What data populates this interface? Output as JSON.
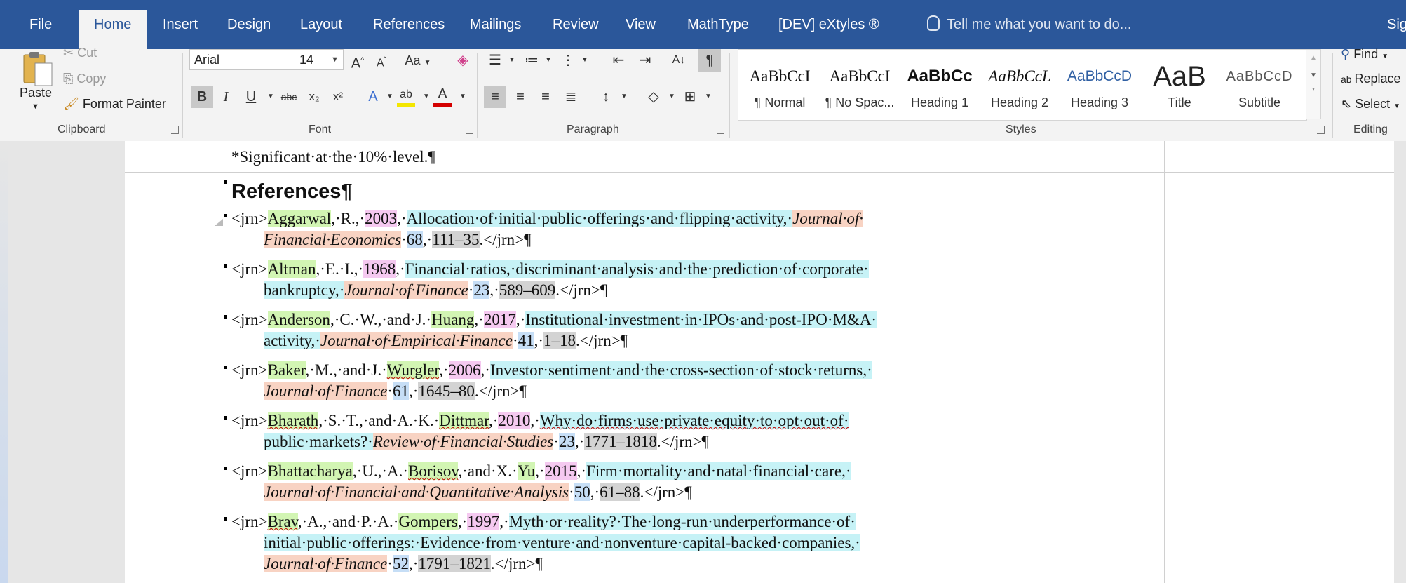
{
  "tabs": [
    {
      "label": "File",
      "active": false
    },
    {
      "label": "Home",
      "active": true
    },
    {
      "label": "Insert",
      "active": false
    },
    {
      "label": "Design",
      "active": false
    },
    {
      "label": "Layout",
      "active": false
    },
    {
      "label": "References",
      "active": false
    },
    {
      "label": "Mailings",
      "active": false
    },
    {
      "label": "Review",
      "active": false
    },
    {
      "label": "View",
      "active": false
    },
    {
      "label": "MathType",
      "active": false
    },
    {
      "label": "[DEV] eXtyles ®",
      "active": false
    }
  ],
  "tell_me": "Tell me what you want to do...",
  "signin": "Sig",
  "clipboard": {
    "label": "Clipboard",
    "paste": "Paste",
    "cut": "Cut",
    "copy": "Copy",
    "format_painter": "Format Painter"
  },
  "font": {
    "label": "Font",
    "family": "Arial",
    "size": "14",
    "case_label": "Aa",
    "superscript": "x²",
    "subscript": "x₂",
    "strike": "abc"
  },
  "paragraph": {
    "label": "Paragraph"
  },
  "styles": {
    "label": "Styles",
    "items": [
      {
        "sample": "AaBbCcI",
        "name": "¶ Normal"
      },
      {
        "sample": "AaBbCcI",
        "name": "¶ No Spac..."
      },
      {
        "sample": "AaBbCc",
        "name": "Heading 1"
      },
      {
        "sample": "AaBbCcL",
        "name": "Heading 2"
      },
      {
        "sample": "AaBbCcD",
        "name": "Heading 3"
      },
      {
        "sample": "AaB",
        "name": "Title"
      },
      {
        "sample": "AaBbCcD",
        "name": "Subtitle"
      }
    ]
  },
  "editing": {
    "label": "Editing",
    "find": "Find",
    "replace": "Replace",
    "select": "Select"
  },
  "colors": {
    "ribbon_blue": "#2b579a",
    "author": "#d2f5b3",
    "year": "#f5c9f0",
    "title": "#c6f2f6",
    "journal": "#f8d3c3",
    "volume": "#c6def6",
    "pages": "#d3d3d3"
  },
  "document": {
    "footnote": "*Significant·at·the·10%·level.¶",
    "heading": "References¶",
    "references": [
      {
        "lines": [
          [
            [
              "",
              "<jrn>"
            ],
            [
              "auth",
              "Aggarwal"
            ],
            [
              "",
              ",·R.,·"
            ],
            [
              "year",
              "2003"
            ],
            [
              "",
              ",·"
            ],
            [
              "title",
              "Allocation·of·initial·public·offerings·and·flipping·activity,·"
            ],
            [
              "jrnl",
              "Journal·of·"
            ]
          ],
          [
            [
              "jrnl",
              "Financial·Economics"
            ],
            [
              "",
              "·"
            ],
            [
              "vol",
              "68"
            ],
            [
              "",
              ",·"
            ],
            [
              "pg",
              "111–35"
            ],
            [
              "",
              ".</jrn>¶"
            ]
          ]
        ]
      },
      {
        "lines": [
          [
            [
              "",
              "<jrn>"
            ],
            [
              "auth",
              "Altman"
            ],
            [
              "",
              ",·E.·I.,·"
            ],
            [
              "year",
              "1968"
            ],
            [
              "",
              ",·"
            ],
            [
              "title",
              "Financial·ratios,·discriminant·analysis·and·the·prediction·of·corporate·"
            ]
          ],
          [
            [
              "title",
              "bankruptcy,·"
            ],
            [
              "jrnl",
              "Journal·of·Finance"
            ],
            [
              "",
              "·"
            ],
            [
              "vol",
              "23"
            ],
            [
              "",
              ",·"
            ],
            [
              "pg",
              "589–609"
            ],
            [
              "",
              ".</jrn>¶"
            ]
          ]
        ]
      },
      {
        "lines": [
          [
            [
              "",
              "<jrn>"
            ],
            [
              "auth",
              "Anderson"
            ],
            [
              "",
              ",·C.·W.,·and·J.·"
            ],
            [
              "auth",
              "Huang"
            ],
            [
              "",
              ",·"
            ],
            [
              "year",
              "2017"
            ],
            [
              "",
              ",·"
            ],
            [
              "title",
              "Institutional·investment·in·IPOs·and·post-IPO·M&A·"
            ]
          ],
          [
            [
              "title",
              "activity,·"
            ],
            [
              "jrnl",
              "Journal·of·Empirical·Finance"
            ],
            [
              "",
              "·"
            ],
            [
              "vol",
              "41"
            ],
            [
              "",
              ",·"
            ],
            [
              "pg",
              "1–18"
            ],
            [
              "",
              ".</jrn>¶"
            ]
          ]
        ]
      },
      {
        "lines": [
          [
            [
              "",
              "<jrn>"
            ],
            [
              "auth",
              "Baker"
            ],
            [
              "",
              ",·M.,·and·J.·"
            ],
            [
              "auth",
              "Wurgler"
            ],
            [
              "",
              ",·"
            ],
            [
              "year",
              "2006"
            ],
            [
              "",
              ",·"
            ],
            [
              "title",
              "Investor·sentiment·and·the·cross-section·of·stock·returns,·"
            ]
          ],
          [
            [
              "jrnl",
              "Journal·of·Finance"
            ],
            [
              "",
              "·"
            ],
            [
              "vol",
              "61"
            ],
            [
              "",
              ",·"
            ],
            [
              "pg",
              "1645–80"
            ],
            [
              "",
              ".</jrn>¶"
            ]
          ]
        ]
      },
      {
        "lines": [
          [
            [
              "",
              "<jrn>"
            ],
            [
              "auth",
              "Bharath"
            ],
            [
              "",
              ",·S.·T.,·and·A.·K.·"
            ],
            [
              "auth",
              "Dittmar"
            ],
            [
              "",
              ",·"
            ],
            [
              "year",
              "2010"
            ],
            [
              "",
              ",·"
            ],
            [
              "title",
              "Why·do·firms·use·private·equity·to·opt·out·of·"
            ]
          ],
          [
            [
              "title",
              "public·markets?·"
            ],
            [
              "jrnl",
              "Review·of·Financial·Studies"
            ],
            [
              "",
              "·"
            ],
            [
              "vol",
              "23"
            ],
            [
              "",
              ",·"
            ],
            [
              "pg",
              "1771–1818"
            ],
            [
              "",
              ".</jrn>¶"
            ]
          ]
        ]
      },
      {
        "lines": [
          [
            [
              "",
              "<jrn>"
            ],
            [
              "auth",
              "Bhattacharya"
            ],
            [
              "",
              ",·U.,·A.·"
            ],
            [
              "auth",
              "Borisov"
            ],
            [
              "",
              ",·and·X.·"
            ],
            [
              "auth",
              "Yu"
            ],
            [
              "",
              ",·"
            ],
            [
              "year",
              "2015"
            ],
            [
              "",
              ",·"
            ],
            [
              "title",
              "Firm·mortality·and·natal·financial·care,·"
            ]
          ],
          [
            [
              "jrnl",
              "Journal·of·Financial·and·Quantitative·Analysis"
            ],
            [
              "",
              "·"
            ],
            [
              "vol",
              "50"
            ],
            [
              "",
              ",·"
            ],
            [
              "pg",
              "61–88"
            ],
            [
              "",
              ".</jrn>¶"
            ]
          ]
        ]
      },
      {
        "lines": [
          [
            [
              "",
              "<jrn>"
            ],
            [
              "auth",
              "Brav"
            ],
            [
              "",
              ",·A.,·and·P.·A.·"
            ],
            [
              "auth",
              "Gompers"
            ],
            [
              "",
              ",·"
            ],
            [
              "year",
              "1997"
            ],
            [
              "",
              ",·"
            ],
            [
              "title",
              "Myth·or·reality?·The·long-run·underperformance·of·"
            ]
          ],
          [
            [
              "title",
              "initial·public·offerings:·Evidence·from·venture·and·nonventure·capital-backed·companies,·"
            ]
          ],
          [
            [
              "jrnl",
              "Journal·of·Finance"
            ],
            [
              "",
              "·"
            ],
            [
              "vol",
              "52"
            ],
            [
              "",
              ",·"
            ],
            [
              "pg",
              "1791–1821"
            ],
            [
              "",
              ".</jrn>¶"
            ]
          ]
        ]
      }
    ]
  }
}
